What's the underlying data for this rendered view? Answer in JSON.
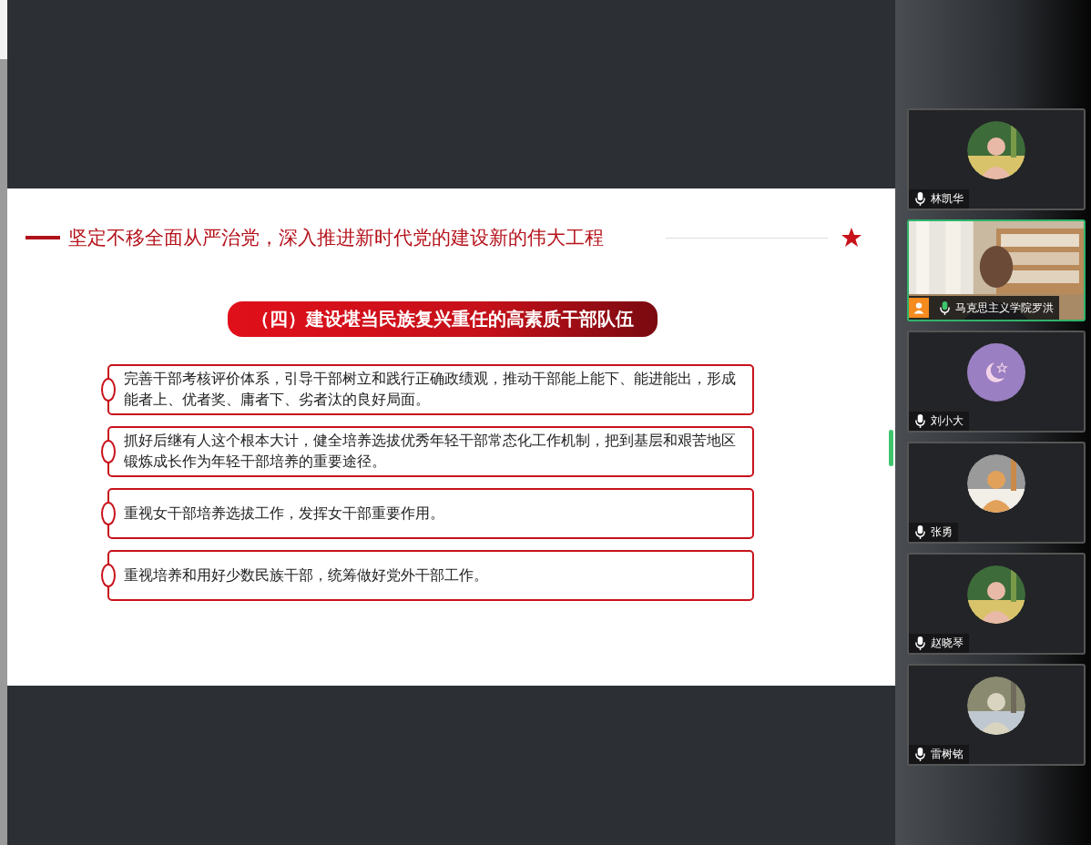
{
  "slide": {
    "title": "坚定不移全面从严治党，深入推进新时代党的建设新的伟大工程",
    "section": "（四）建设堪当民族复兴重任的高素质干部队伍",
    "items": [
      "完善干部考核评价体系，引导干部树立和践行正确政绩观，推动干部能上能下、能进能出，形成能者上、优者奖、庸者下、劣者汰的良好局面。",
      "抓好后继有人这个根本大计，健全培养选拔优秀年轻干部常态化工作机制，把到基层和艰苦地区锻炼成长作为年轻干部培养的重要途径。",
      "重视女干部培养选拔工作，发挥女干部重要作用。",
      "重视培养和用好少数民族干部，统筹做好党外干部工作。"
    ]
  },
  "participants": [
    {
      "name": "林凯华",
      "selected": false
    },
    {
      "name": "马克思主义学院罗洪",
      "kind": "video",
      "selected": true
    },
    {
      "name": "刘小大",
      "kind": "icon",
      "selected": false
    },
    {
      "name": "张勇",
      "selected": false
    },
    {
      "name": "赵晓琴",
      "selected": false
    },
    {
      "name": "雷树铭",
      "selected": false
    }
  ]
}
